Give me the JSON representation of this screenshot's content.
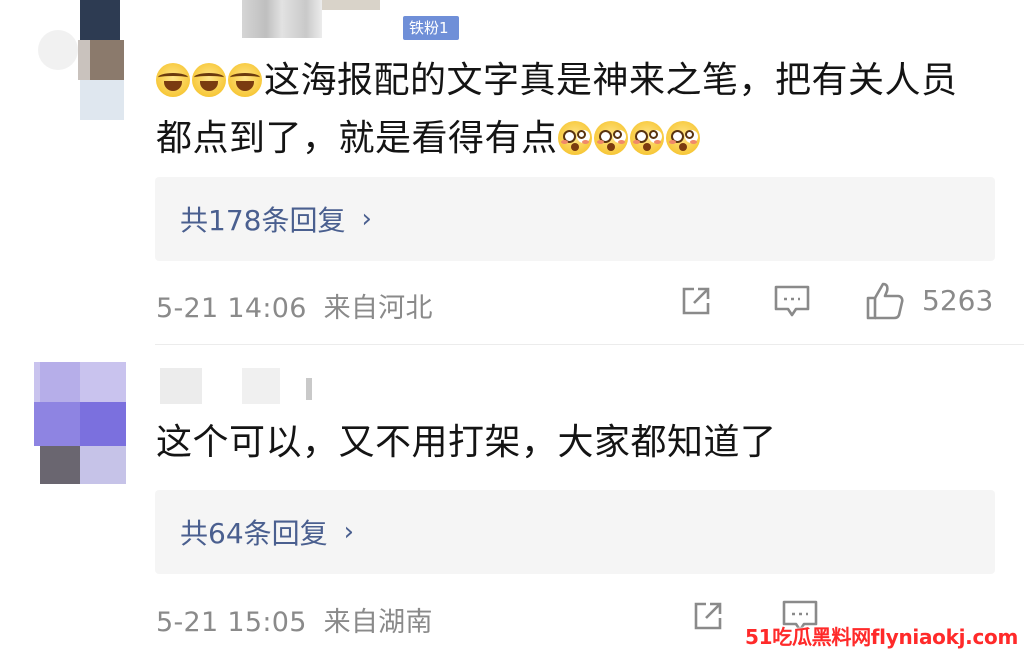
{
  "comments": [
    {
      "fan_badge": "铁粉1",
      "emojis_leading": [
        "laugh-cry-emoji",
        "laugh-cry-emoji",
        "laugh-cry-emoji"
      ],
      "text_line1": "这海报配的文字真是神来之笔，把有关人员",
      "text_line2": "都点到了，就是看得有点",
      "emojis_trailing": [
        "flushed-emoji",
        "flushed-emoji",
        "flushed-emoji",
        "flushed-emoji"
      ],
      "reply_label": "共178条回复",
      "reply_chevron": "›",
      "time": "5-21 14:06",
      "location": "来自河北",
      "like_count": "5263"
    },
    {
      "text_line1": "这个可以，又不用打架，大家都知道了",
      "reply_label": "共64条回复",
      "reply_chevron": "›",
      "time": "5-21 15:05",
      "location": "来自湖南"
    }
  ],
  "watermark": "51吃瓜黑料网flyniaokj.com",
  "colors": {
    "reply_text": "#4a5f8f",
    "reply_bg": "#f5f5f5",
    "meta_text": "#8a8a8a",
    "fan_badge_bg": "#6f8fd8",
    "watermark": "#ff2a2a"
  },
  "icons": [
    "share-icon",
    "comment-icon",
    "thumbs-up-icon"
  ]
}
